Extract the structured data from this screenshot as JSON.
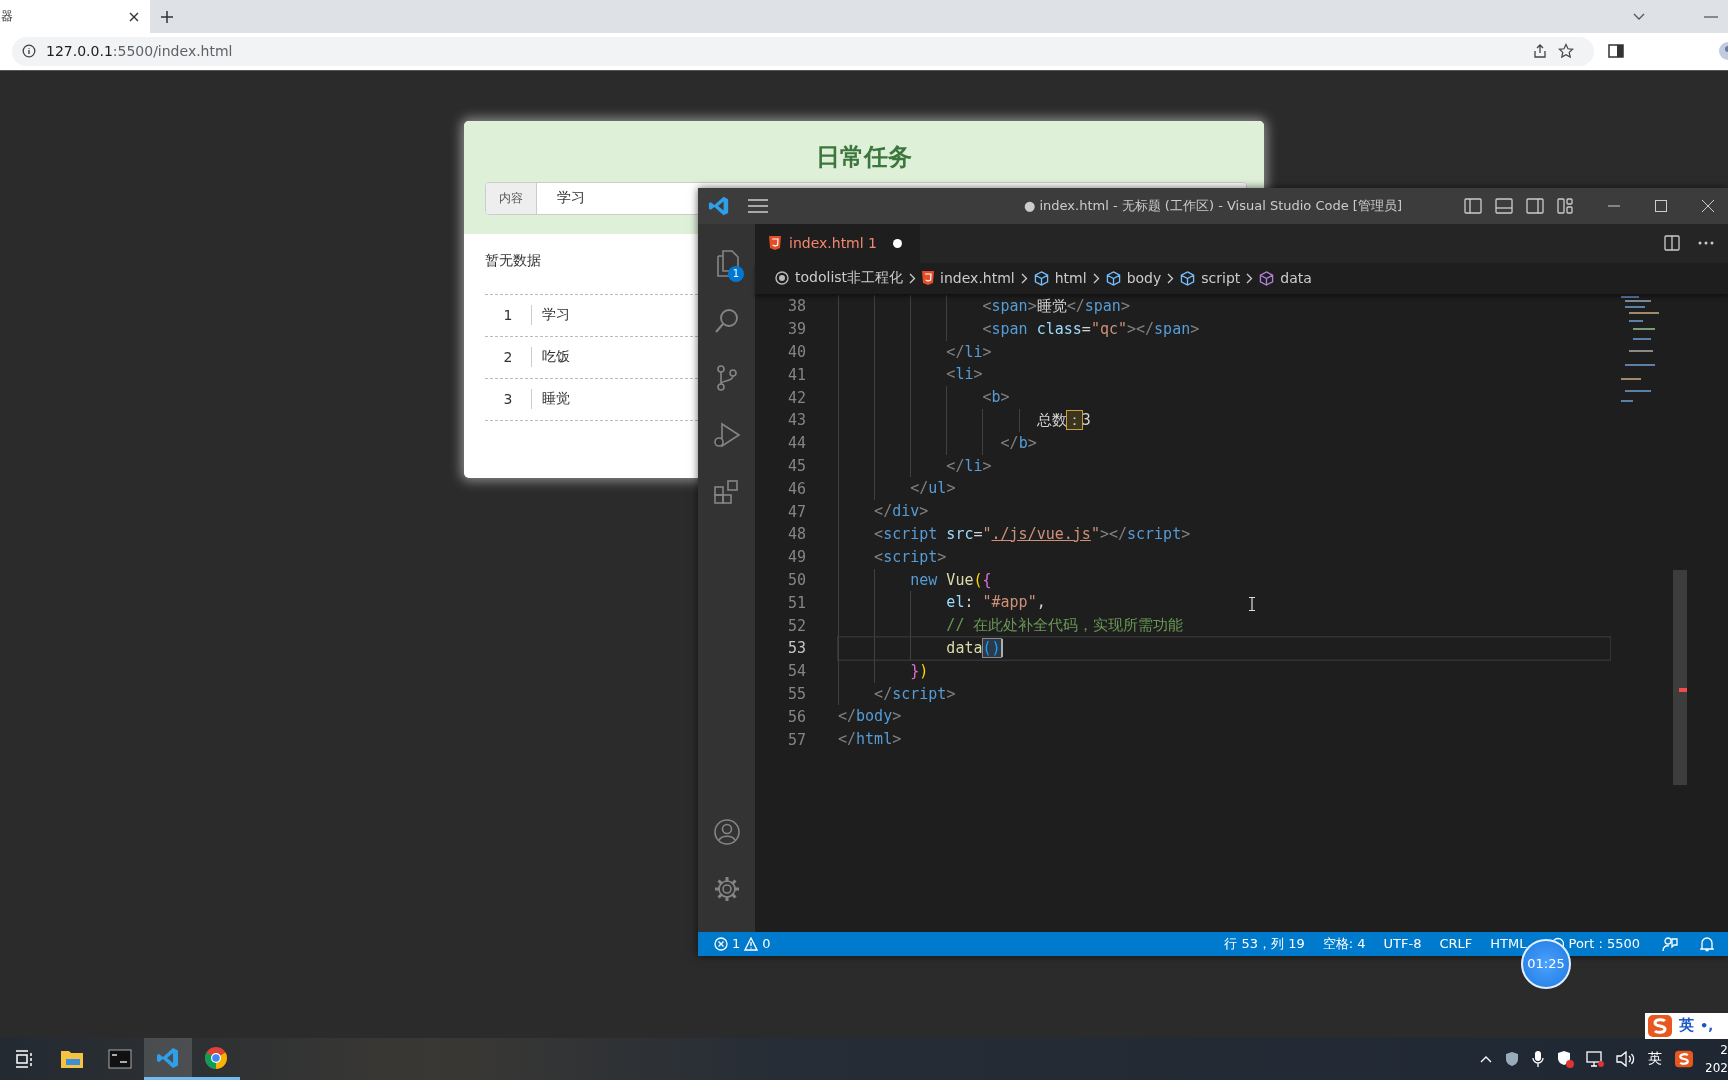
{
  "browser": {
    "tab_title": "器",
    "url_host": "127.0.0.1",
    "url_path": ":5500/index.html"
  },
  "todo": {
    "title": "日常任务",
    "input_label": "内容",
    "input_value": "学习",
    "empty_text": "暂无数据",
    "items": [
      {
        "number": "1",
        "text": "学习"
      },
      {
        "number": "2",
        "text": "吃饭"
      },
      {
        "number": "3",
        "text": "睡觉"
      }
    ]
  },
  "vscode": {
    "title": "● index.html - 无标题 (工作区) - Visual Studio Code [管理员]",
    "tab": {
      "label": "index.html",
      "problems": "1",
      "modified": true
    },
    "activity": [
      {
        "kind": "explorer",
        "badge": "1"
      },
      {
        "kind": "search"
      },
      {
        "kind": "source-control"
      },
      {
        "kind": "run"
      },
      {
        "kind": "extensions"
      },
      {
        "kind": "account"
      },
      {
        "kind": "settings"
      }
    ],
    "breadcrumb": [
      {
        "kind": "folder",
        "label": "todolist非工程化"
      },
      {
        "kind": "html",
        "label": "index.html"
      },
      {
        "kind": "element",
        "label": "html"
      },
      {
        "kind": "element",
        "label": "body"
      },
      {
        "kind": "element",
        "label": "script"
      },
      {
        "kind": "method",
        "label": "data"
      }
    ],
    "lines": [
      {
        "number": "38",
        "current": false,
        "tokens": [
          {
            "t": "                <",
            "kind": "punct"
          },
          {
            "t": "span",
            "kind": "tag"
          },
          {
            "t": ">",
            "kind": "punct"
          },
          {
            "t": "睡觉",
            "kind": "text"
          },
          {
            "t": "</",
            "kind": "punct"
          },
          {
            "t": "span",
            "kind": "tag"
          },
          {
            "t": ">",
            "kind": "punct"
          }
        ]
      },
      {
        "number": "39",
        "current": false,
        "tokens": [
          {
            "t": "                <",
            "kind": "punct"
          },
          {
            "t": "span",
            "kind": "tag"
          },
          {
            "t": " class",
            "kind": "attr"
          },
          {
            "t": "=",
            "kind": "text"
          },
          {
            "t": "\"qc\"",
            "kind": "string"
          },
          {
            "t": "></",
            "kind": "punct"
          },
          {
            "t": "span",
            "kind": "tag"
          },
          {
            "t": ">",
            "kind": "punct"
          }
        ]
      },
      {
        "number": "40",
        "current": false,
        "tokens": [
          {
            "t": "            </",
            "kind": "punct"
          },
          {
            "t": "li",
            "kind": "tag"
          },
          {
            "t": ">",
            "kind": "punct"
          }
        ]
      },
      {
        "number": "41",
        "current": false,
        "tokens": [
          {
            "t": "            <",
            "kind": "punct"
          },
          {
            "t": "li",
            "kind": "tag"
          },
          {
            "t": ">",
            "kind": "punct"
          }
        ]
      },
      {
        "number": "42",
        "current": false,
        "tokens": [
          {
            "t": "                <",
            "kind": "punct"
          },
          {
            "t": "b",
            "kind": "tag"
          },
          {
            "t": ">",
            "kind": "punct"
          }
        ]
      },
      {
        "number": "43",
        "current": false,
        "tokens": [
          {
            "t": "                      总数",
            "kind": "text"
          },
          {
            "t": "：",
            "kind": "highlight"
          },
          {
            "t": "3",
            "kind": "text"
          }
        ]
      },
      {
        "number": "44",
        "current": false,
        "tokens": [
          {
            "t": "                  </",
            "kind": "punct"
          },
          {
            "t": "b",
            "kind": "tag"
          },
          {
            "t": ">",
            "kind": "punct"
          }
        ]
      },
      {
        "number": "45",
        "current": false,
        "tokens": [
          {
            "t": "            </",
            "kind": "punct"
          },
          {
            "t": "li",
            "kind": "tag"
          },
          {
            "t": ">",
            "kind": "punct"
          }
        ]
      },
      {
        "number": "46",
        "current": false,
        "tokens": [
          {
            "t": "        </",
            "kind": "punct"
          },
          {
            "t": "ul",
            "kind": "tag"
          },
          {
            "t": ">",
            "kind": "punct"
          }
        ]
      },
      {
        "number": "47",
        "current": false,
        "tokens": [
          {
            "t": "    </",
            "kind": "punct"
          },
          {
            "t": "div",
            "kind": "tag"
          },
          {
            "t": ">",
            "kind": "punct"
          }
        ]
      },
      {
        "number": "48",
        "current": false,
        "tokens": [
          {
            "t": "    <",
            "kind": "punct"
          },
          {
            "t": "script",
            "kind": "tag"
          },
          {
            "t": " src",
            "kind": "attr"
          },
          {
            "t": "=",
            "kind": "text"
          },
          {
            "t": "\"",
            "kind": "string"
          },
          {
            "t": "./js/vue.js",
            "kind": "link"
          },
          {
            "t": "\"",
            "kind": "string"
          },
          {
            "t": "></",
            "kind": "punct"
          },
          {
            "t": "script",
            "kind": "tag"
          },
          {
            "t": ">",
            "kind": "punct"
          }
        ]
      },
      {
        "number": "49",
        "current": false,
        "tokens": [
          {
            "t": "    <",
            "kind": "punct"
          },
          {
            "t": "script",
            "kind": "tag"
          },
          {
            "t": ">",
            "kind": "punct"
          }
        ]
      },
      {
        "number": "50",
        "current": false,
        "tokens": [
          {
            "t": "        new",
            "kind": "keyword"
          },
          {
            "t": " Vue",
            "kind": "function"
          },
          {
            "t": "(",
            "kind": "paren"
          },
          {
            "t": "{",
            "kind": "brace"
          }
        ]
      },
      {
        "number": "51",
        "current": false,
        "tokens": [
          {
            "t": "            el",
            "kind": "attr"
          },
          {
            "t": ": ",
            "kind": "text"
          },
          {
            "t": "\"#app\"",
            "kind": "string"
          },
          {
            "t": ",",
            "kind": "text"
          }
        ]
      },
      {
        "number": "52",
        "current": false,
        "tokens": [
          {
            "t": "            // 在此处补全代码，实现所需功能",
            "kind": "comment"
          }
        ]
      },
      {
        "number": "53",
        "current": true,
        "tokens": [
          {
            "t": "            data",
            "kind": "function"
          },
          {
            "t": "()",
            "kind": "bracket-match"
          }
        ]
      },
      {
        "number": "54",
        "current": false,
        "tokens": [
          {
            "t": "        }",
            "kind": "brace"
          },
          {
            "t": ")",
            "kind": "paren"
          }
        ]
      },
      {
        "number": "55",
        "current": false,
        "tokens": [
          {
            "t": "    </",
            "kind": "punct"
          },
          {
            "t": "script",
            "kind": "tag"
          },
          {
            "t": ">",
            "kind": "punct"
          }
        ]
      },
      {
        "number": "56",
        "current": false,
        "tokens": [
          {
            "t": "</",
            "kind": "punct"
          },
          {
            "t": "body",
            "kind": "tag"
          },
          {
            "t": ">",
            "kind": "punct"
          }
        ]
      },
      {
        "number": "57",
        "current": false,
        "tokens": [
          {
            "t": "</",
            "kind": "punct"
          },
          {
            "t": "html",
            "kind": "tag"
          },
          {
            "t": ">",
            "kind": "punct"
          }
        ]
      }
    ],
    "status": {
      "errors": "1",
      "warnings": "0",
      "items": [
        {
          "kind": "text",
          "label": "行 53，列 19"
        },
        {
          "kind": "text",
          "label": "空格: 4"
        },
        {
          "kind": "text",
          "label": "UTF-8"
        },
        {
          "kind": "text",
          "label": "CRLF"
        },
        {
          "kind": "text",
          "label": "HTML"
        },
        {
          "kind": "port",
          "label": "Port : 5500"
        },
        {
          "kind": "feedback"
        },
        {
          "kind": "bell"
        }
      ]
    }
  },
  "timer": "01:25",
  "ime": {
    "label": "英",
    "punct": "•,"
  },
  "taskbar": {
    "apps": [
      {
        "kind": "taskview",
        "selected": false,
        "running": false
      },
      {
        "kind": "folder",
        "selected": false,
        "running": false
      },
      {
        "kind": "terminal",
        "selected": false,
        "running": false
      },
      {
        "kind": "vscode",
        "selected": true,
        "running": true
      },
      {
        "kind": "chrome",
        "selected": false,
        "running": true
      }
    ],
    "language": "英",
    "clock": [
      "2",
      "202"
    ]
  }
}
